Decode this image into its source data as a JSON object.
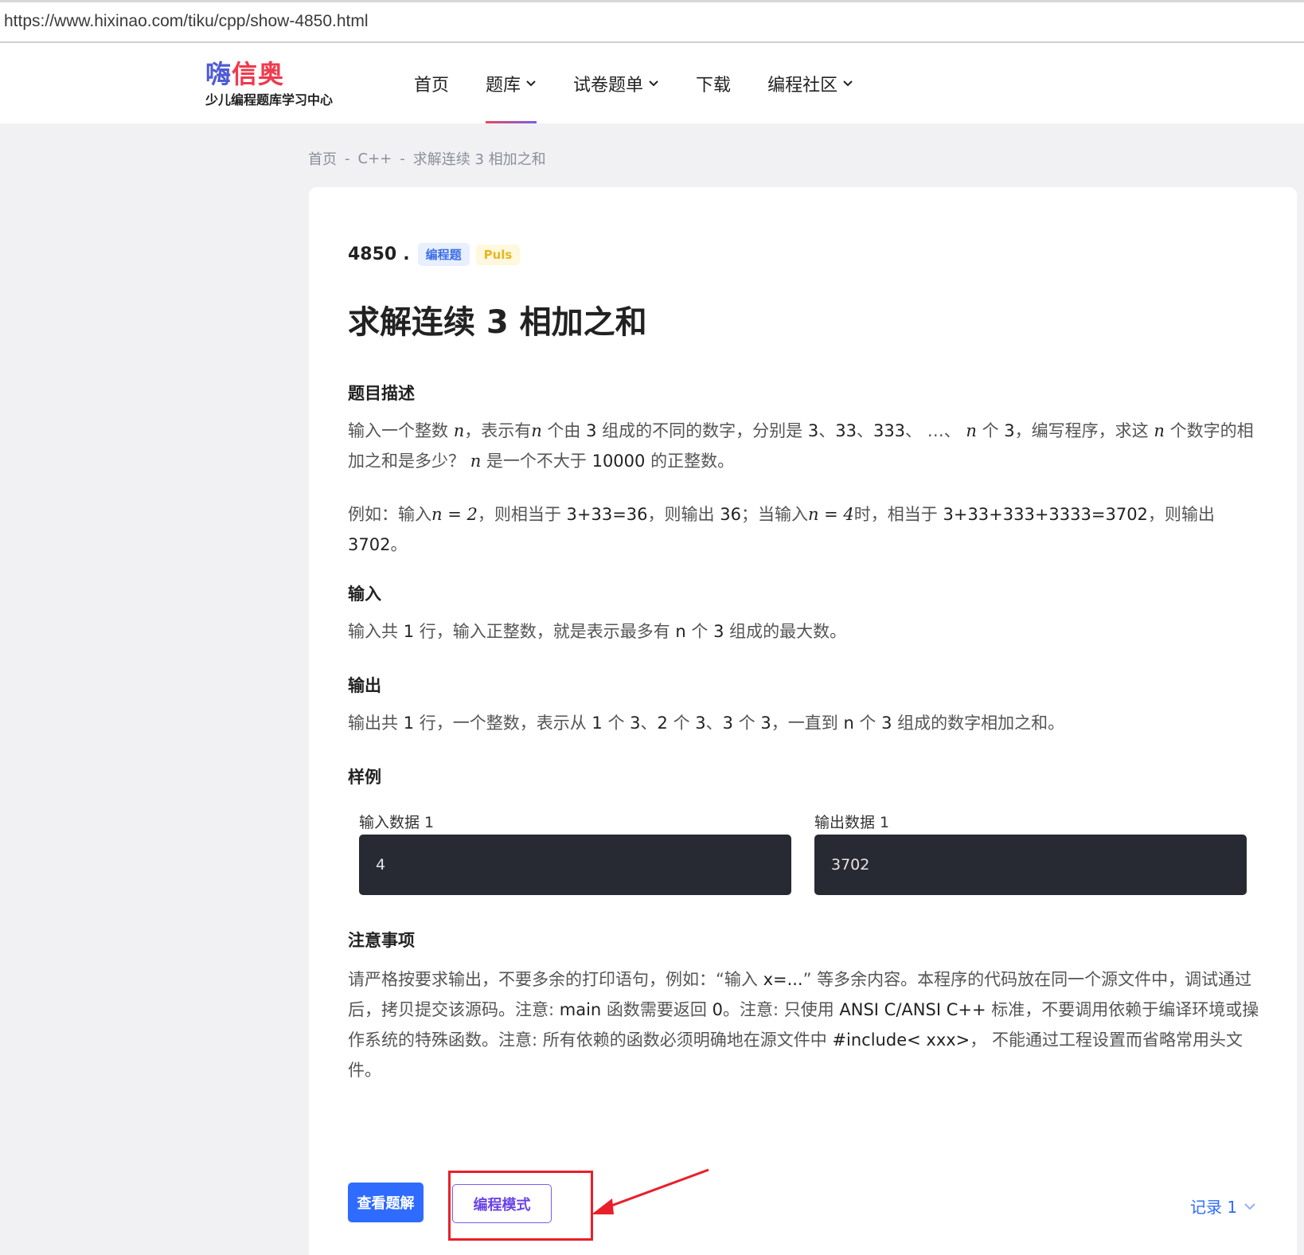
{
  "browser": {
    "url": "https://www.hixinao.com/tiku/cpp/show-4850.html"
  },
  "header": {
    "logo": {
      "part1": "嗨",
      "part2": "信奥",
      "subtitle": "少儿编程题库学习中心"
    },
    "nav": [
      {
        "label": "首页",
        "dropdown": false
      },
      {
        "label": "题库",
        "dropdown": true,
        "active": true
      },
      {
        "label": "试卷题单",
        "dropdown": true
      },
      {
        "label": "下载",
        "dropdown": false
      },
      {
        "label": "编程社区",
        "dropdown": true
      }
    ]
  },
  "breadcrumb": {
    "items": [
      "首页",
      "C++",
      "求解连续 3 相加之和"
    ],
    "separator": "-"
  },
  "problem": {
    "id": "4850",
    "dot": ".",
    "tag_type": "编程题",
    "tag_plus": "Puls",
    "title": "求解连续 3 相加之和",
    "desc_heading": "题目描述",
    "desc_p1": {
      "t1": "输入一个整数 ",
      "v1": "n",
      "t2": "，表示有",
      "v2": "n",
      "t3": " 个由 ",
      "e1": "3",
      "t4": " 组成的不同的数字，分别是 ",
      "e2": "3",
      "t5": "、",
      "e3": "33",
      "t6": "、",
      "e4": "333",
      "t7": "、 …、 ",
      "v3": "n",
      "t8": " 个 ",
      "e5": "3",
      "t9": "，编写程序，求这 ",
      "v4": "n",
      "t10": " 个数字的相加之和是多少？ ",
      "v5": "n",
      "t11": " 是一个不大于 ",
      "e6": "10000",
      "t12": " 的正整数。"
    },
    "desc_p2": {
      "t1": "例如：输入",
      "m1": "n = 2",
      "t2": "，则相当于 ",
      "e1": "3+33=36",
      "t3": "，则输出 ",
      "e2": "36",
      "t4": "；当输入",
      "m2": "n = 4",
      "t5": "时，相当于 ",
      "e3": "3+33+333+3333=3702",
      "t6": "，则输出 ",
      "e4": "3702",
      "t7": "。"
    },
    "input_heading": "输入",
    "input_text": {
      "t1": "输入共 ",
      "e1": "1",
      "t2": " 行，输入正整数，就是表示最多有 ",
      "e2": "n",
      "t3": " 个 ",
      "e3": "3",
      "t4": " 组成的最大数。"
    },
    "output_heading": "输出",
    "output_text": {
      "t1": "输出共 ",
      "e1": "1",
      "t2": " 行，一个整数，表示从 ",
      "e2": "1",
      "t3": " 个 ",
      "e3": "3",
      "t4": "、",
      "e4": "2",
      "t5": " 个 ",
      "e5": "3",
      "t6": "、",
      "e6": "3",
      "t7": " 个 ",
      "e7": "3",
      "t8": "，一直到 ",
      "e8": "n",
      "t9": " 个 ",
      "e9": "3",
      "t10": " 组成的数字相加之和。"
    },
    "sample_heading": "样例",
    "sample_input_label": "输入数据 1",
    "sample_input_value": "4",
    "sample_output_label": "输出数据 1",
    "sample_output_value": "3702",
    "notes_heading": "注意事项",
    "notes_text": {
      "t1": "请严格按要求输出，不要多余的打印语句，例如：“输入 ",
      "e1": "x=...",
      "t2": "” 等多余内容。本程序的代码放在同一个源文件中，调试通过后，拷贝提交该源码。注意: ",
      "e2": "main",
      "t3": " 函数需要返回 ",
      "e3": "0",
      "t4": "。注意: 只使用 ",
      "e4": "ANSI C/ANSI C++",
      "t5": " 标准，不要调用依赖于编译环境或操作系统的特殊函数。注意: 所有依赖的函数必须明确地在源文件中 ",
      "e5": "#include< xxx>",
      "t6": "， 不能通过工程设置而省略常用头文件。"
    }
  },
  "actions": {
    "solution_label": "查看题解",
    "code_mode_label": "编程模式",
    "records_label": "记录 1"
  },
  "colors": {
    "primary": "#2f6bff",
    "purple": "#6a44e8",
    "annotation": "#e8202a",
    "logo_blue": "#4f5bd5",
    "logo_red": "#ef3a4c"
  }
}
